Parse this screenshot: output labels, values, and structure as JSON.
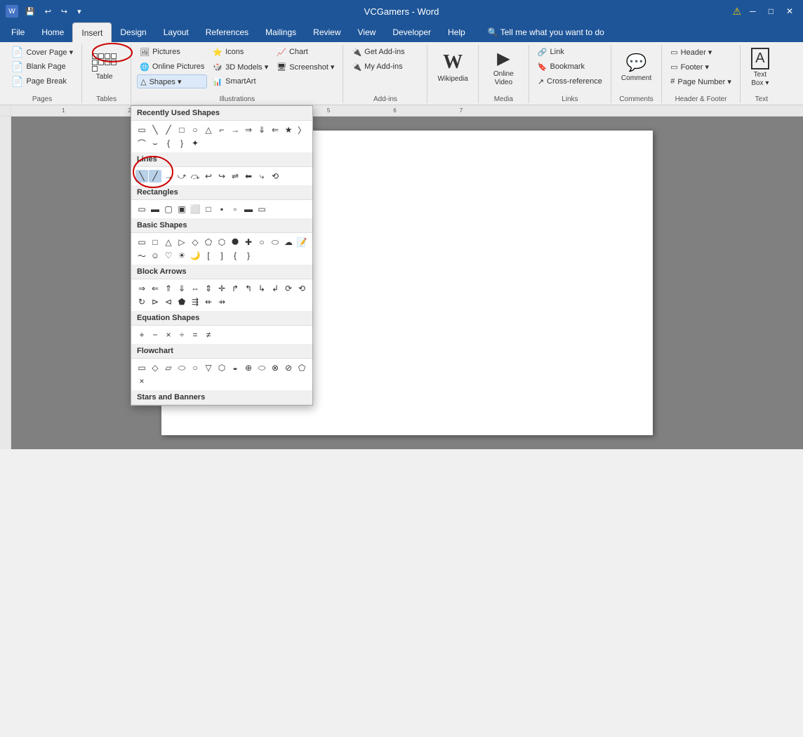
{
  "titleBar": {
    "title": "VCGamers - Word",
    "warning": "⚠",
    "qat": [
      "💾",
      "↩",
      "↪",
      "▾"
    ]
  },
  "tabs": [
    {
      "id": "file",
      "label": "File"
    },
    {
      "id": "home",
      "label": "Home"
    },
    {
      "id": "insert",
      "label": "Insert",
      "active": true,
      "highlighted": true
    },
    {
      "id": "design",
      "label": "Design"
    },
    {
      "id": "layout",
      "label": "Layout"
    },
    {
      "id": "references",
      "label": "References"
    },
    {
      "id": "mailings",
      "label": "Mailings"
    },
    {
      "id": "review",
      "label": "Review"
    },
    {
      "id": "view",
      "label": "View"
    },
    {
      "id": "developer",
      "label": "Developer"
    },
    {
      "id": "help",
      "label": "Help"
    },
    {
      "id": "search",
      "label": "🔍 Tell me what you want to do"
    }
  ],
  "ribbon": {
    "groups": [
      {
        "id": "pages",
        "label": "Pages",
        "items": [
          {
            "id": "cover-page",
            "label": "Cover Page ▾",
            "icon": "📄"
          },
          {
            "id": "blank-page",
            "label": "Blank Page",
            "icon": "📄"
          },
          {
            "id": "page-break",
            "label": "Page Break",
            "icon": "📄"
          }
        ]
      },
      {
        "id": "tables",
        "label": "Tables",
        "items": [
          {
            "id": "table",
            "label": "Table",
            "icon": "⊞"
          }
        ]
      },
      {
        "id": "illustrations",
        "label": "Illustrations",
        "items": [
          {
            "id": "pictures",
            "label": "Pictures",
            "icon": "🖼"
          },
          {
            "id": "online-pictures",
            "label": "Online Pictures",
            "icon": "🌐"
          },
          {
            "id": "shapes",
            "label": "Shapes ▾",
            "icon": "△",
            "highlighted": true
          },
          {
            "id": "icons",
            "label": "Icons",
            "icon": "⭐"
          },
          {
            "id": "3d-models",
            "label": "3D Models ▾",
            "icon": "🎲"
          },
          {
            "id": "smartart",
            "label": "SmartArt",
            "icon": "📊"
          },
          {
            "id": "chart",
            "label": "Chart",
            "icon": "📈"
          },
          {
            "id": "screenshot",
            "label": "Screenshot ▾",
            "icon": "🖥"
          }
        ]
      },
      {
        "id": "addins",
        "label": "Add-ins",
        "items": [
          {
            "id": "get-addins",
            "label": "Get Add-ins",
            "icon": "🔌"
          },
          {
            "id": "my-addins",
            "label": "My Add-ins",
            "icon": "🔌"
          }
        ]
      },
      {
        "id": "wikipedia-group",
        "label": "",
        "items": [
          {
            "id": "wikipedia",
            "label": "Wikipedia",
            "icon": "W"
          }
        ]
      },
      {
        "id": "media",
        "label": "Media",
        "items": [
          {
            "id": "online-video",
            "label": "Online Video",
            "icon": "▶"
          }
        ]
      },
      {
        "id": "links",
        "label": "Links",
        "items": [
          {
            "id": "link",
            "label": "Link",
            "icon": "🔗"
          },
          {
            "id": "bookmark",
            "label": "Bookmark",
            "icon": "🔖"
          },
          {
            "id": "cross-reference",
            "label": "Cross-reference",
            "icon": "↗"
          }
        ]
      },
      {
        "id": "comments",
        "label": "Comments",
        "items": [
          {
            "id": "comment",
            "label": "Comment",
            "icon": "💬"
          }
        ]
      },
      {
        "id": "header-footer",
        "label": "Header & Footer",
        "items": [
          {
            "id": "header",
            "label": "Header ▾",
            "icon": "▭"
          },
          {
            "id": "footer",
            "label": "Footer ▾",
            "icon": "▭"
          },
          {
            "id": "page-number",
            "label": "Page Number ▾",
            "icon": "#"
          }
        ]
      },
      {
        "id": "text",
        "label": "Text",
        "items": [
          {
            "id": "text-box",
            "label": "Text Box ▾",
            "icon": "A"
          }
        ]
      }
    ]
  },
  "shapesDropdown": {
    "sections": [
      {
        "id": "recently-used",
        "label": "Recently Used Shapes",
        "shapes": [
          "▭",
          "╲",
          "╱",
          "▭",
          "○",
          "△",
          "╗",
          "→",
          "⇒",
          "⇓",
          "⇐",
          "☆",
          "⟩",
          "⌒",
          "⌣",
          "❴",
          "❵",
          "✦"
        ]
      },
      {
        "id": "lines",
        "label": "Lines",
        "shapes": [
          "╲",
          "╱",
          "→",
          "⤻",
          "⤼",
          "↩",
          "↪",
          "⇌",
          "⬅",
          "⤷",
          "⟲"
        ]
      },
      {
        "id": "rectangles",
        "label": "Rectangles",
        "shapes": [
          "▭",
          "▭",
          "▭",
          "▭",
          "▭",
          "▭",
          "▭",
          "▭",
          "▭",
          "▭"
        ]
      },
      {
        "id": "basic-shapes",
        "label": "Basic Shapes",
        "shapes": [
          "▭",
          "▭",
          "△",
          "▷",
          "◇",
          "⬠",
          "○",
          "●",
          "◑",
          "⊙",
          "◎",
          "□",
          "▣",
          "◰",
          "⌒",
          "◻",
          "⊡",
          "✦",
          "✧",
          "✩",
          "☺",
          "♡",
          "✂",
          "☀",
          "🌙",
          "⌀",
          "〔",
          "〕",
          "⌂",
          "⌧"
        ]
      },
      {
        "id": "block-arrows",
        "label": "Block Arrows",
        "shapes": [
          "⇒",
          "⇐",
          "⇑",
          "⇓",
          "⇔",
          "⇕",
          "⇱",
          "⇲",
          "↱",
          "↲",
          "↰",
          "↳",
          "⟳",
          "⟲",
          "↻",
          "↺",
          "⊕",
          "⊗",
          "⊘",
          "⊙",
          "⊚",
          "⇶",
          "⇷",
          "⇸",
          "⇹",
          "⇺"
        ]
      },
      {
        "id": "equation-shapes",
        "label": "Equation Shapes",
        "shapes": [
          "+",
          "−",
          "×",
          "÷",
          "=",
          "≠"
        ]
      },
      {
        "id": "flowchart",
        "label": "Flowchart",
        "shapes": [
          "▭",
          "▭",
          "◇",
          "▱",
          "▭",
          "▭",
          "▭",
          "⬭",
          "▭",
          "◯",
          "▽",
          "△",
          "▭",
          "▭",
          "▭",
          "⌂",
          "◎",
          "⊕",
          "✕",
          "△",
          "▲",
          "▭",
          "▹"
        ]
      },
      {
        "id": "stars-banners",
        "label": "Stars and Banners",
        "shapes": []
      }
    ]
  },
  "document": {
    "content": ""
  }
}
